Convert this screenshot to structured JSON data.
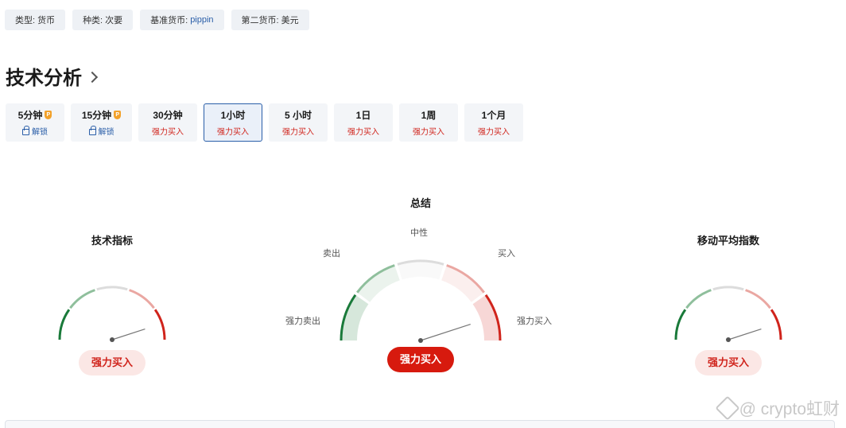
{
  "tags": [
    {
      "label": "类型:",
      "value": "货币",
      "link": false
    },
    {
      "label": "种类:",
      "value": "次要",
      "link": false
    },
    {
      "label": "基准货币:",
      "value": "pippin",
      "link": true
    },
    {
      "label": "第二货币:",
      "value": "美元",
      "link": false
    }
  ],
  "section": {
    "title": "技术分析"
  },
  "timeframes": [
    {
      "name": "5分钟",
      "status": "解锁",
      "locked": true,
      "active": false
    },
    {
      "name": "15分钟",
      "status": "解锁",
      "locked": true,
      "active": false
    },
    {
      "name": "30分钟",
      "status": "强力买入",
      "locked": false,
      "active": false
    },
    {
      "name": "1小时",
      "status": "强力买入",
      "locked": false,
      "active": true
    },
    {
      "name": "5 小时",
      "status": "强力买入",
      "locked": false,
      "active": false
    },
    {
      "name": "1日",
      "status": "强力买入",
      "locked": false,
      "active": false
    },
    {
      "name": "1周",
      "status": "强力买入",
      "locked": false,
      "active": false
    },
    {
      "name": "1个月",
      "status": "强力买入",
      "locked": false,
      "active": false
    }
  ],
  "gauges": {
    "technical": {
      "title": "技术指标",
      "result": "强力买入",
      "needle_level": 0.9
    },
    "summary": {
      "title": "总结",
      "result": "强力买入",
      "needle_level": 0.9,
      "labels": {
        "strong_sell": "强力卖出",
        "sell": "卖出",
        "neutral": "中性",
        "buy": "买入",
        "strong_buy": "强力买入"
      }
    },
    "moving_averages": {
      "title": "移动平均指数",
      "result": "强力买入",
      "needle_level": 0.9
    }
  },
  "colors": {
    "strong_sell": "#1a7a3a",
    "sell": "#8fbf9c",
    "neutral": "#dcdcdc",
    "buy": "#eaa7a2",
    "strong_buy": "#d0241c",
    "accent_blue": "#2a5ea8"
  },
  "watermark": {
    "text": "@ crypto虹财"
  }
}
